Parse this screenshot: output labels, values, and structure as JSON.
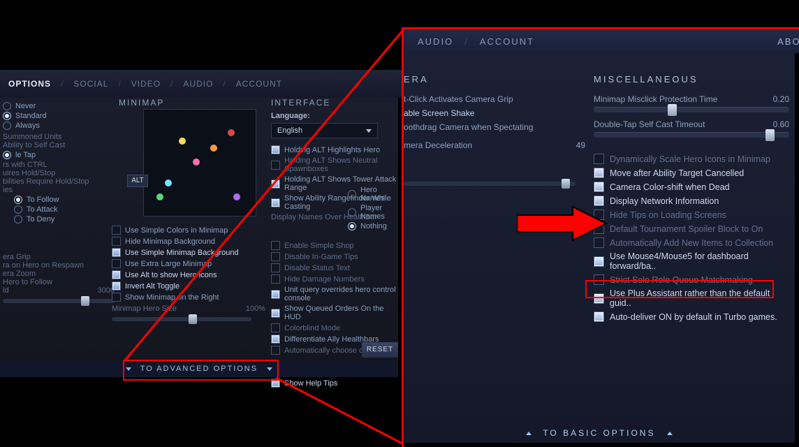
{
  "left_tabs": {
    "options": "OPTIONS",
    "social": "SOCIAL",
    "video": "VIDEO",
    "audio": "AUDIO",
    "account": "ACCOUNT"
  },
  "radios": {
    "never": "Never",
    "standard": "Standard",
    "always": "Always"
  },
  "left_col1": {
    "summoned": "Summoned Units",
    "selfcast": "Ability to Self Cast",
    "tap": "le Tap",
    "ctrl": "rs with CTRL",
    "holdstop": "uires Hold/Stop",
    "abil_holdstop": "bilities Require Hold/Stop",
    "ies": "ies",
    "tofollow": "To Follow",
    "toattack": "To Attack",
    "todeny": "To Deny",
    "grip": "era Grip",
    "respawn": "ra on Hero on Respawn",
    "zoom": "era Zoom",
    "hfollow": "Hero to Follow",
    "ld": "ld",
    "ld_val": "3000"
  },
  "minimap_hdr": "MINIMAP",
  "alt_tip": "ALT",
  "mm_opts": {
    "simple_colors": "Use Simple Colors in Minimap",
    "hide_bg": "Hide Minimap Background",
    "simple_bg": "Use Simple Minimap Background",
    "extra_large": "Use Extra Large Minimap",
    "alt_icons": "Use Alt to show Hero icons",
    "invert_alt": "Invert Alt Toggle",
    "on_right": "Show Minimap on the Right",
    "hero_size": "Minimap Hero Size",
    "hero_size_val": "100%"
  },
  "interface": {
    "hdr": "INTERFACE",
    "lang_lbl": "Language:",
    "lang_val": "English",
    "alt_hero": "Holding ALT Highlights Hero",
    "alt_spawn": "Holding ALT Shows Neutral Spawnboxes",
    "alt_tower": "Holding ALT Shows Tower Attack Range",
    "rangefinder": "Show Ability Rangefinder While Casting",
    "names_over": "Display Names Over Healthbar",
    "hero_names": "Hero Names",
    "player_names": "Player Names",
    "nothing": "Nothing",
    "simple_shop": "Enable Simple Shop",
    "disable_tips": "Disable In-Game Tips",
    "disable_status": "Disable Status Text",
    "hide_dmg": "Hide Damage Numbers",
    "unit_query": "Unit query overrides hero control console",
    "queued_hud": "Show Queued Orders On the HUD",
    "colorblind": "Colorblind Mode",
    "diff_ally": "Differentiate Ally Healthbars",
    "auto_cursor": "Automatically choose cursor size",
    "help_tips": "Show Help Tips",
    "reset": "RESET"
  },
  "adv_label": "TO ADVANCED OPTIONS",
  "right_tabs": {
    "audio": "AUDIO",
    "account": "ACCOUNT",
    "about": "ABOU"
  },
  "camera": {
    "hdr": "ERA",
    "grip": "t-Click Activates Camera Grip",
    "shake": "able Screen Shake",
    "smooth": "oothdrag Camera when Spectating",
    "decel": "mera Deceleration",
    "decel_val": "49"
  },
  "misc": {
    "hdr": "MISCELLANEOUS",
    "misclick": "Minimap Misclick Protection Time",
    "misclick_val": "0.20",
    "dbltap": "Double-Tap Self Cast Timeout",
    "dbltap_val": "0.60",
    "scale_icons": "Dynamically Scale Hero Icons in Minimap",
    "move_cancel": "Move after Ability Target Cancelled",
    "color_dead": "Camera Color-shift when Dead",
    "netinfo": "Display Network Information",
    "hide_tips": "Hide Tips on Loading Screens",
    "spoiler": "Default Tournament Spoiler Block to On",
    "auto_add": "Automatically Add New Items to Collection",
    "mouse45": "Use Mouse4/Mouse5 for dashboard forward/ba..",
    "solo_role": "Strict Solo Role Queue Matchmaking",
    "plus_assist": "Use Plus Assistant rather than the default guid..",
    "auto_deliver": "Auto-deliver ON by default in Turbo games."
  },
  "basic_label": "TO BASIC OPTIONS"
}
